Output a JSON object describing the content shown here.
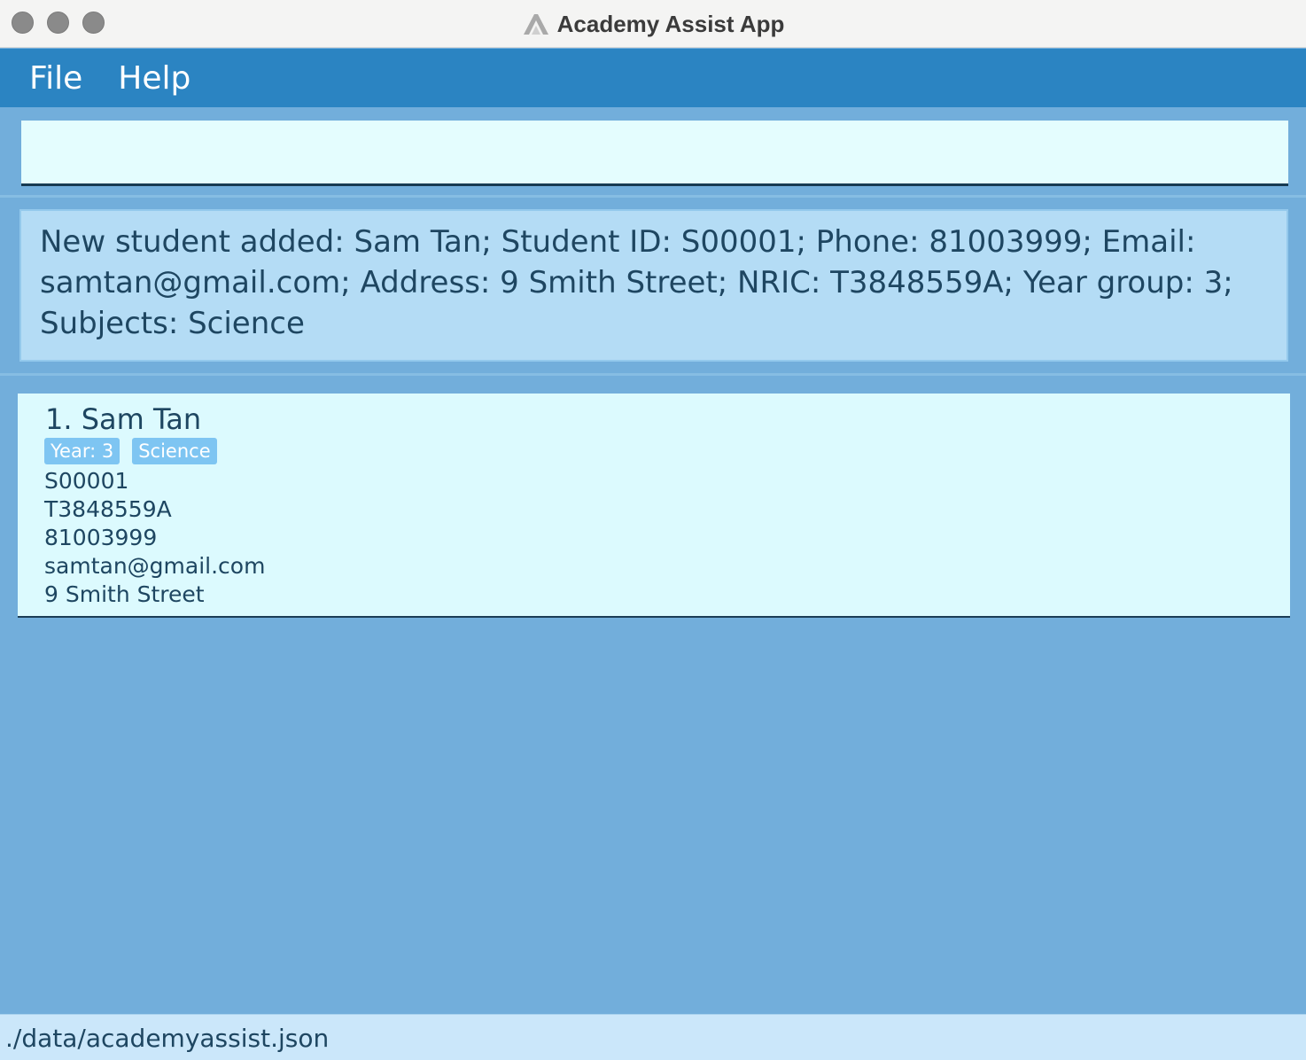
{
  "window": {
    "title": "Academy Assist App",
    "app_icon": "academy-assist-logo-icon"
  },
  "menu": {
    "items": [
      {
        "label": "File"
      },
      {
        "label": "Help"
      }
    ]
  },
  "command_box": {
    "value": "",
    "placeholder": ""
  },
  "result_display": {
    "text": "New student added: Sam Tan; Student ID: S00001; Phone: 81003999; Email: samtan@gmail.com; Address: 9 Smith Street; NRIC: T3848559A; Year group: 3; Subjects: Science"
  },
  "student_list": {
    "items": [
      {
        "index_name": "1. Sam Tan",
        "tags": [
          "Year: 3",
          "Science"
        ],
        "student_id": "S00001",
        "nric": "T3848559A",
        "phone": "81003999",
        "email": "samtan@gmail.com",
        "address": "9 Smith Street"
      }
    ]
  },
  "status_bar": {
    "file_path": "./data/academyassist.json"
  },
  "colors": {
    "menubar": "#2b84c2",
    "background": "#72aedb",
    "card": "#dcfafe",
    "tag": "#7ec5f2",
    "result_box": "#b4dcf5",
    "text": "#1e4661"
  }
}
